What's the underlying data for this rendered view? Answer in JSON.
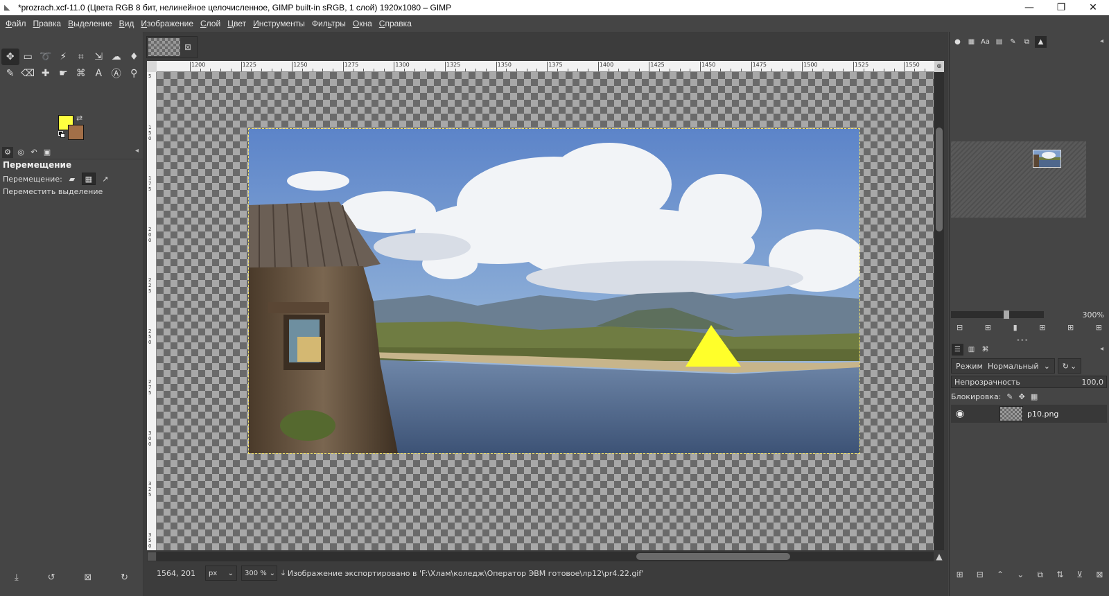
{
  "window": {
    "title": "*prozrach.xcf-11.0 (Цвета RGB 8 бит, нелинейное целочисленное, GIMP built-in sRGB, 1 слой) 1920x1080 – GIMP",
    "minimize": "—",
    "maximize": "❐",
    "close": "✕"
  },
  "menu": [
    {
      "pre": "",
      "ul": "Ф",
      "post": "айл"
    },
    {
      "pre": "",
      "ul": "П",
      "post": "равка"
    },
    {
      "pre": "",
      "ul": "В",
      "post": "ыделение"
    },
    {
      "pre": "",
      "ul": "В",
      "post": "ид"
    },
    {
      "pre": "",
      "ul": "И",
      "post": "зображение"
    },
    {
      "pre": "",
      "ul": "С",
      "post": "лой"
    },
    {
      "pre": "",
      "ul": "Ц",
      "post": "вет"
    },
    {
      "pre": "",
      "ul": "И",
      "post": "нструменты"
    },
    {
      "pre": "Фил",
      "ul": "ь",
      "post": "тры"
    },
    {
      "pre": "",
      "ul": "О",
      "post": "кна"
    },
    {
      "pre": "",
      "ul": "С",
      "post": "правка"
    }
  ],
  "toolbox": {
    "tools": [
      {
        "name": "move-tool-icon",
        "glyph": "✥",
        "active": true
      },
      {
        "name": "rect-select-icon",
        "glyph": "▭"
      },
      {
        "name": "lasso-icon",
        "glyph": "➰"
      },
      {
        "name": "fuzzy-select-icon",
        "glyph": "⚡"
      },
      {
        "name": "crop-icon",
        "glyph": "⌗"
      },
      {
        "name": "unified-transform-icon",
        "glyph": "⇲"
      },
      {
        "name": "warp-transform-icon",
        "glyph": "☁"
      },
      {
        "name": "bucket-fill-icon",
        "glyph": "♦"
      },
      {
        "name": "paintbrush-icon",
        "glyph": "✎"
      },
      {
        "name": "eraser-icon",
        "glyph": "⌫"
      },
      {
        "name": "heal-icon",
        "glyph": "✚"
      },
      {
        "name": "smudge-icon",
        "glyph": "☛"
      },
      {
        "name": "paths-icon",
        "glyph": "⌘"
      },
      {
        "name": "text-tool-icon",
        "glyph": "A"
      },
      {
        "name": "color-picker-icon",
        "glyph": "Ⓐ"
      },
      {
        "name": "zoom-icon",
        "glyph": "⚲"
      }
    ],
    "fg_color": "#ffff40",
    "bg_color": "#a26f48"
  },
  "tool_options": {
    "title": "Перемещение",
    "move_label": "Перемещение:",
    "option": "Переместить выделение"
  },
  "image_tab": {
    "close": "⊠"
  },
  "ruler": {
    "labels": [
      "1200",
      "1225",
      "1250",
      "1275",
      "1300",
      "1325",
      "1350",
      "1375",
      "1400",
      "1425",
      "1450",
      "1475",
      "1500",
      "1525",
      "1550"
    ],
    "left_labels": [
      "5",
      "1 5 0",
      "1 7 5",
      "2 0 0",
      "2 2 5",
      "2 5 0",
      "2 7 5",
      "3 0 0",
      "3 2 5",
      "3 5 0"
    ]
  },
  "status": {
    "coords": "1564, 201",
    "unit": "px",
    "zoom": "300 %",
    "message": "Изображение экспортировано в 'F:\\Хлам\\коледж\\Оператор ЭВМ готовое\\лр12\\pr4.22.gif'"
  },
  "navigator": {
    "zoom_value": "300%"
  },
  "layers": {
    "mode_label": "Режим",
    "mode_value": "Нормальный",
    "opacity_label": "Непрозрачность",
    "opacity_value": "100,0",
    "lock_label": "Блокировка:",
    "layer_name": "p10.png"
  }
}
